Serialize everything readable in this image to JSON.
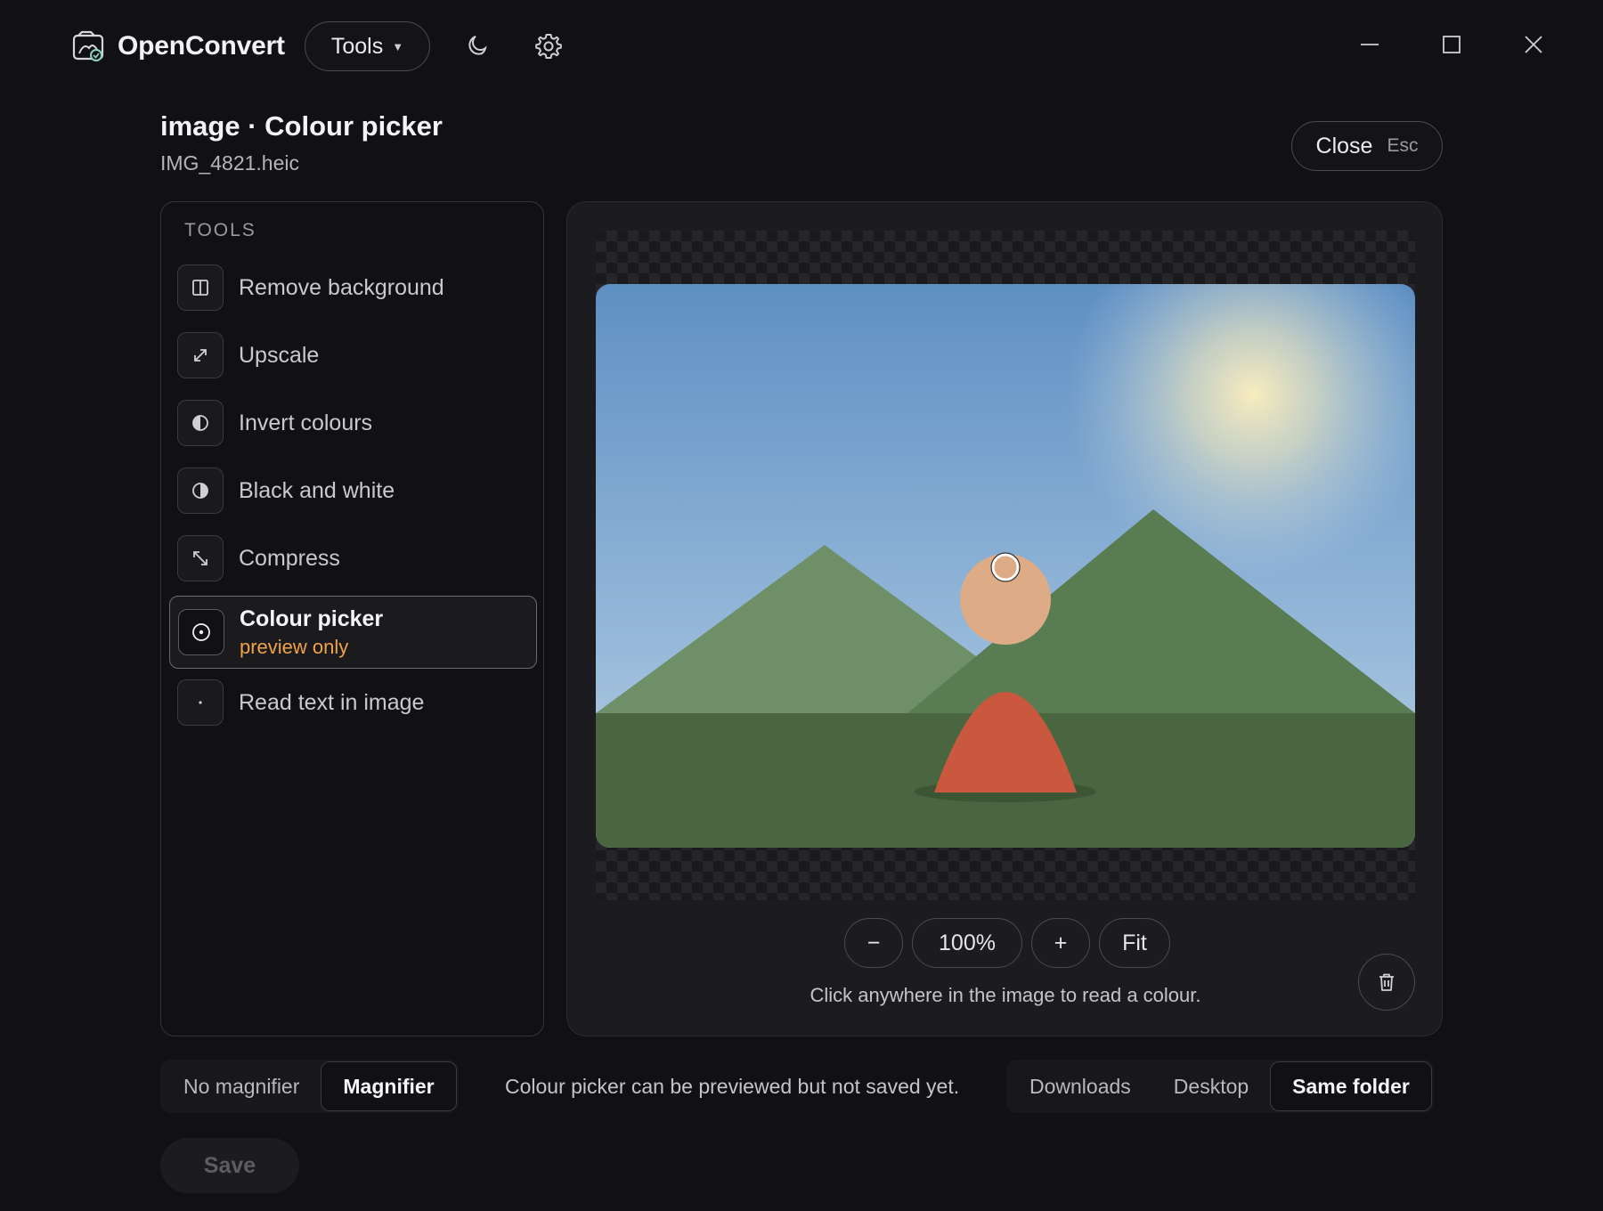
{
  "app": {
    "name": "OpenConvert"
  },
  "titlebar": {
    "tools_label": "Tools"
  },
  "header": {
    "title": "image · Colour picker",
    "filename": "IMG_4821.heic",
    "close_label": "Close",
    "close_shortcut": "Esc"
  },
  "tools": {
    "heading": "TOOLS",
    "items": [
      {
        "label": "Remove background",
        "icon": "split-icon"
      },
      {
        "label": "Upscale",
        "icon": "expand-arrows-icon"
      },
      {
        "label": "Invert colours",
        "icon": "half-circle-icon"
      },
      {
        "label": "Black and white",
        "icon": "contrast-icon"
      },
      {
        "label": "Compress",
        "icon": "compress-arrows-icon"
      },
      {
        "label": "Colour picker",
        "sublabel": "preview only",
        "icon": "target-icon",
        "active": true
      },
      {
        "label": "Read text in image",
        "icon": "dot-icon"
      }
    ]
  },
  "preview": {
    "zoom_out": "−",
    "zoom_level": "100%",
    "zoom_in": "+",
    "fit": "Fit",
    "hint": "Click anywhere in the image to read a colour."
  },
  "magnifier": {
    "options": [
      "No magnifier",
      "Magnifier"
    ],
    "selected": "Magnifier"
  },
  "status": "Colour picker can be previewed but not saved yet.",
  "destination": {
    "options": [
      "Downloads",
      "Desktop",
      "Same folder"
    ],
    "selected": "Same folder"
  },
  "save_label": "Save",
  "colors": {
    "accent_warning": "#f0a14a",
    "background": "#111113",
    "panel": "#1c1c20"
  }
}
